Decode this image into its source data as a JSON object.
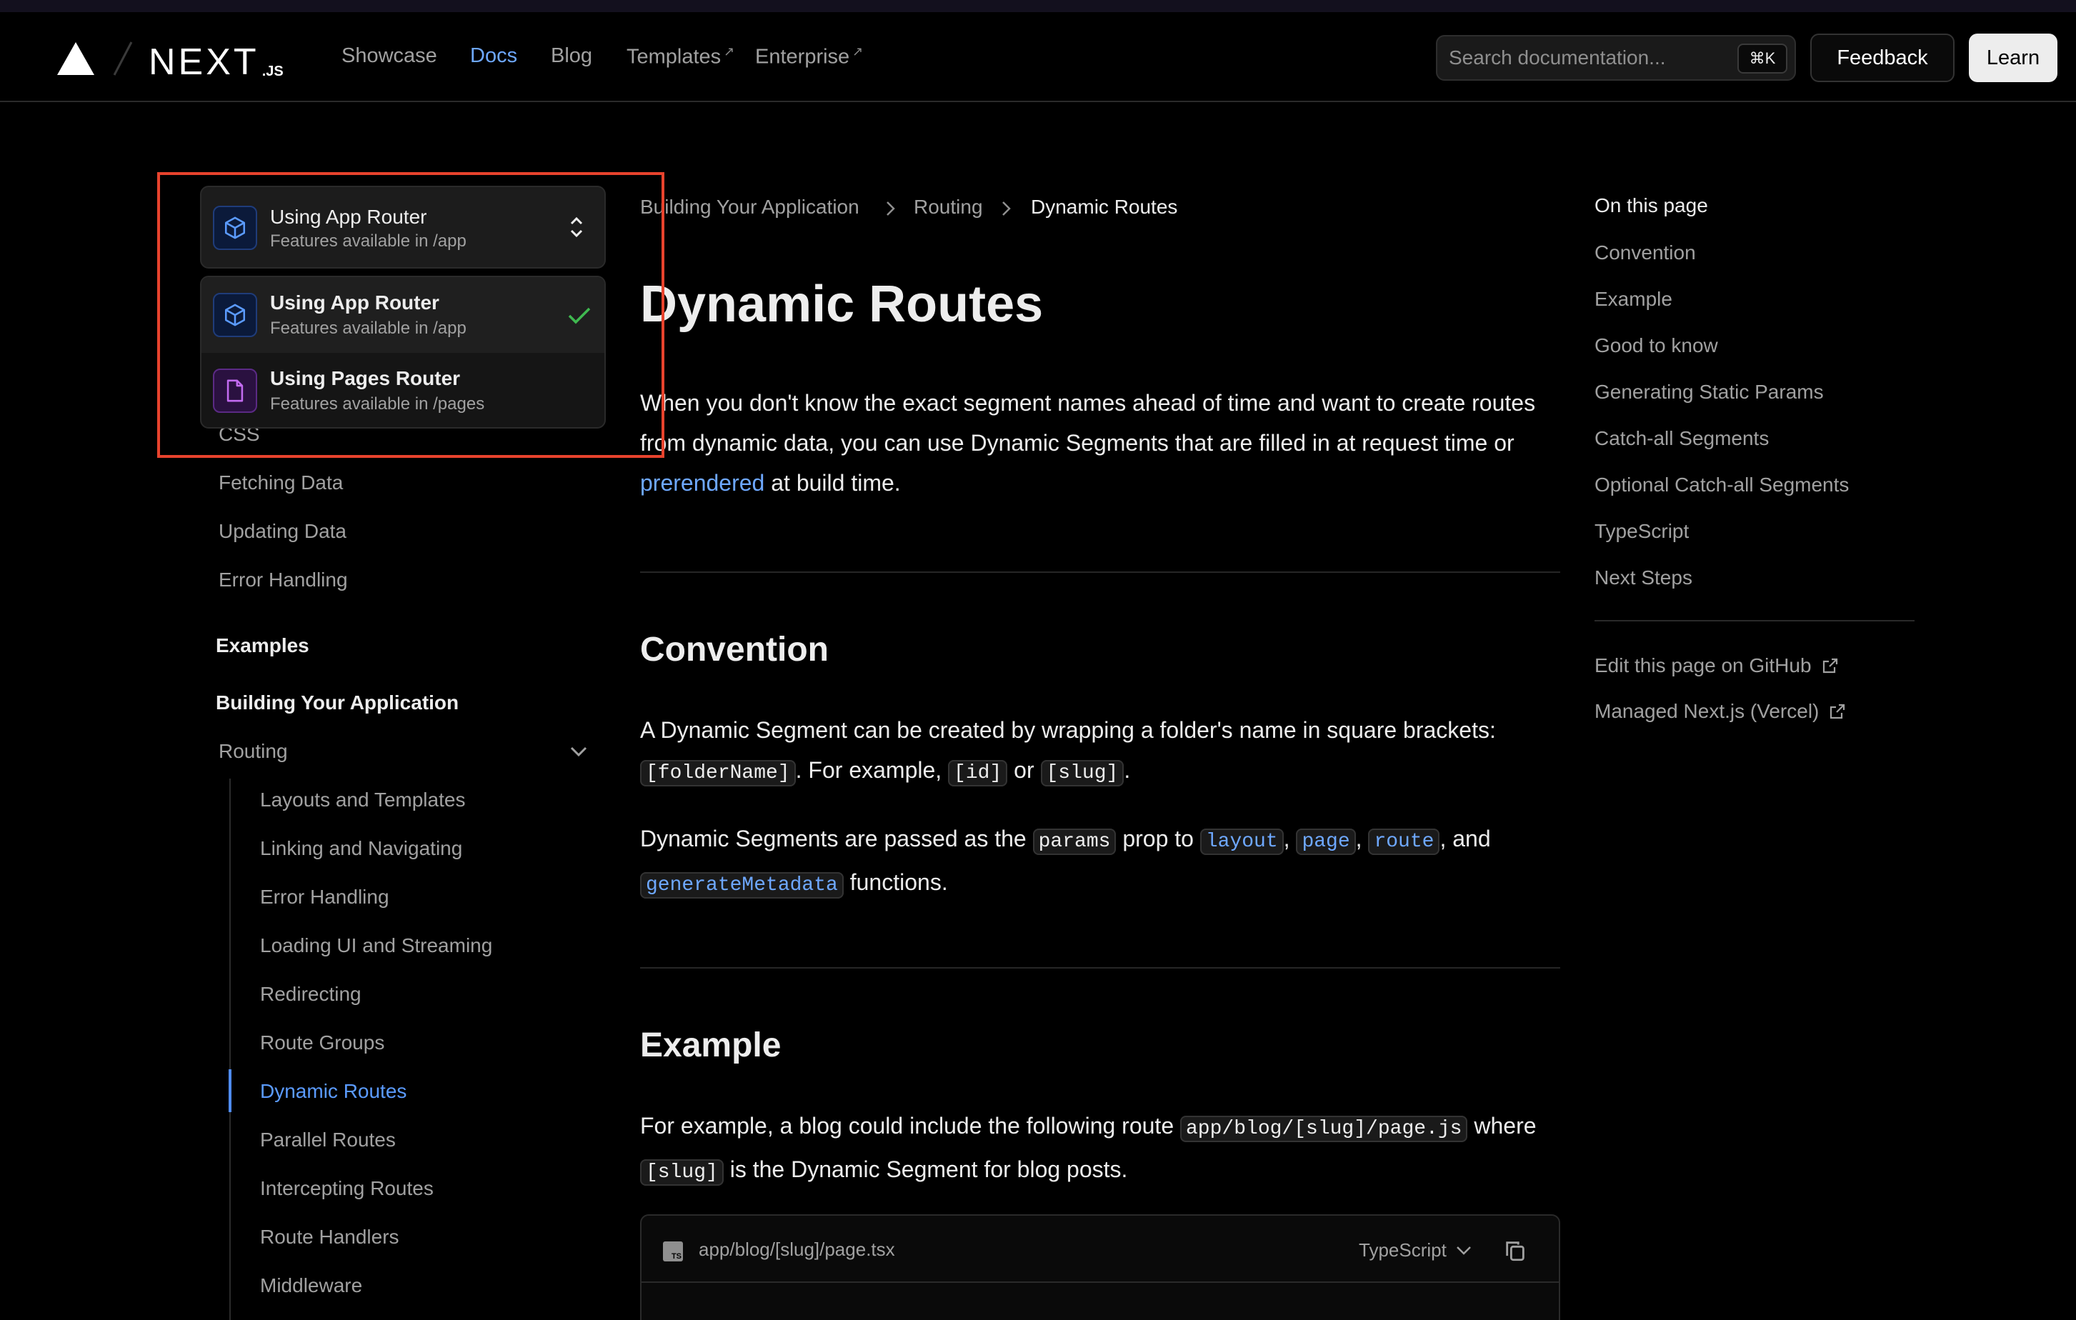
{
  "header": {
    "logo_main": "NEXT",
    "logo_sub": ".JS",
    "nav": [
      {
        "label": "Showcase"
      },
      {
        "label": "Docs"
      },
      {
        "label": "Blog"
      },
      {
        "label": "Templates"
      },
      {
        "label": "Enterprise"
      }
    ],
    "search_placeholder": "Search documentation...",
    "search_shortcut": "⌘K",
    "feedback_label": "Feedback",
    "learn_label": "Learn"
  },
  "router_switcher": {
    "title": "Using App Router",
    "subtitle": "Features available in /app",
    "options": [
      {
        "title": "Using App Router",
        "subtitle": "Features available in /app",
        "selected": true
      },
      {
        "title": "Using Pages Router",
        "subtitle": "Features available in /pages",
        "selected": false
      }
    ]
  },
  "sidebar": {
    "items": [
      {
        "label": "CSS"
      },
      {
        "label": "Fetching Data"
      },
      {
        "label": "Updating Data"
      },
      {
        "label": "Error Handling"
      }
    ],
    "examples_heading": "Examples",
    "building_heading": "Building Your Application",
    "routing_label": "Routing",
    "routing_children": [
      {
        "label": "Layouts and Templates"
      },
      {
        "label": "Linking and Navigating"
      },
      {
        "label": "Error Handling"
      },
      {
        "label": "Loading UI and Streaming"
      },
      {
        "label": "Redirecting"
      },
      {
        "label": "Route Groups"
      },
      {
        "label": "Dynamic Routes"
      },
      {
        "label": "Parallel Routes"
      },
      {
        "label": "Intercepting Routes"
      },
      {
        "label": "Route Handlers"
      },
      {
        "label": "Middleware"
      }
    ]
  },
  "breadcrumb": [
    "Building Your Application",
    "Routing",
    "Dynamic Routes"
  ],
  "content": {
    "title": "Dynamic Routes",
    "intro_before": "When you don't know the exact segment names ahead of time and want to create routes from dynamic data, you can use Dynamic Segments that are filled in at request time or ",
    "intro_link": "prerendered",
    "intro_after": " at build time.",
    "convention_heading": "Convention",
    "convention_p1_a": "A Dynamic Segment can be created by wrapping a folder's name in square brackets: ",
    "convention_code_folder": "[folderName]",
    "convention_p1_b": ". For example, ",
    "convention_code_id": "[id]",
    "convention_p1_c": " or ",
    "convention_code_slug": "[slug]",
    "convention_p1_d": ".",
    "convention_p2_a": "Dynamic Segments are passed as the ",
    "convention_code_params": "params",
    "convention_p2_b": " prop to ",
    "convention_code_layout": "layout",
    "convention_code_page": "page",
    "convention_code_route": "route",
    "convention_p2_c": ", and ",
    "convention_code_gm": "generateMetadata",
    "convention_p2_d": " functions.",
    "comma": ", ",
    "example_heading": "Example",
    "example_p_a": "For example, a blog could include the following route ",
    "example_code_path": "app/blog/[slug]/page.js",
    "example_p_b": " where ",
    "example_code_slug": "[slug]",
    "example_p_c": " is the Dynamic Segment for blog posts.",
    "code_file": "app/blog/[slug]/page.tsx",
    "code_lang": "TypeScript",
    "ts_badge": "TS"
  },
  "toc": {
    "title": "On this page",
    "items": [
      {
        "label": "Convention"
      },
      {
        "label": "Example"
      },
      {
        "label": "Good to know"
      },
      {
        "label": "Generating Static Params"
      },
      {
        "label": "Catch-all Segments"
      },
      {
        "label": "Optional Catch-all Segments"
      },
      {
        "label": "TypeScript"
      },
      {
        "label": "Next Steps"
      }
    ],
    "edit_link": "Edit this page on GitHub",
    "managed_link": "Managed Next.js (Vercel)"
  },
  "colors": {
    "accent": "#5b9bff",
    "highlight_border": "#e8432d",
    "check": "#3fb950"
  }
}
